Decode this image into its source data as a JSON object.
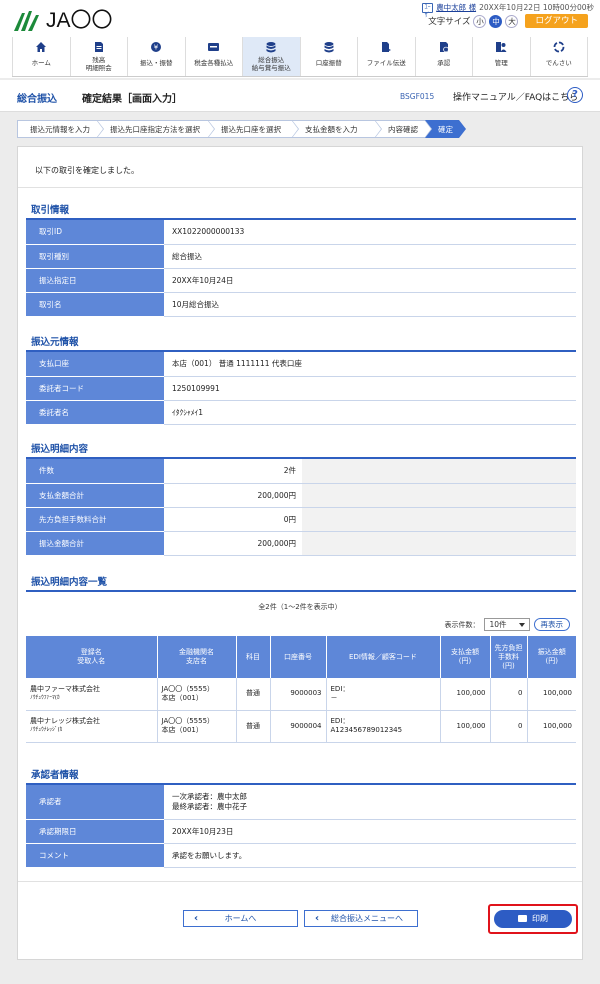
{
  "header": {
    "logo_text": "JA〇〇",
    "user_badge": "ﾕｰｻﾞ",
    "user_name": "農中太郎 様",
    "login_time": "20XX年10月22日 10時00分00秒",
    "font_size_label": "文字サイズ",
    "font_sizes": [
      "小",
      "中",
      "大"
    ],
    "font_size_selected": "中",
    "logout_label": "ログアウト"
  },
  "global_nav": [
    {
      "label": "ホーム",
      "icon": "home-icon"
    },
    {
      "label": "残高\n明細照会",
      "icon": "document-icon"
    },
    {
      "label": "振込・振替",
      "icon": "yen-coin-icon"
    },
    {
      "label": "税金各種払込",
      "icon": "card-icon"
    },
    {
      "label": "総合振込\n給与賞与振込",
      "icon": "coins-stack-icon",
      "active": true
    },
    {
      "label": "口座振替",
      "icon": "coins-stack-icon"
    },
    {
      "label": "ファイル伝送",
      "icon": "file-transfer-icon"
    },
    {
      "label": "承認",
      "icon": "approve-icon"
    },
    {
      "label": "管理",
      "icon": "admin-icon"
    },
    {
      "label": "でんさい",
      "icon": "densai-icon"
    }
  ],
  "title_bar": {
    "section": "総合振込",
    "page": "確定結果［画面入力］",
    "screen_code": "BSGF015",
    "help_link": "操作マニュアル／FAQはこちら",
    "help_icon_text": "?"
  },
  "steps": [
    {
      "label": "振込元情報を入力"
    },
    {
      "label": "振込先口座指定方法を選択"
    },
    {
      "label": "振込先口座を選択"
    },
    {
      "label": "支払金額を入力"
    },
    {
      "label": "内容確認"
    },
    {
      "label": "確定",
      "current": true
    }
  ],
  "message": "以下の取引を確定しました。",
  "transaction": {
    "title": "取引情報",
    "rows": [
      {
        "key": "取引ID",
        "value": "XX1022000000133"
      },
      {
        "key": "取引種別",
        "value": "総合振込"
      },
      {
        "key": "振込指定日",
        "value": "20XX年10月24日"
      },
      {
        "key": "取引名",
        "value": "10月総合振込"
      }
    ]
  },
  "source": {
    "title": "振込元情報",
    "rows": [
      {
        "key": "支払口座",
        "value": "本店（001）  普通 1111111 代表口座"
      },
      {
        "key": "委託者コード",
        "value": "1250109991"
      },
      {
        "key": "委託者名",
        "value": "ｲﾀｸｼｬﾒｲ1"
      }
    ]
  },
  "details": {
    "title": "振込明細内容",
    "rows": [
      {
        "key": "件数",
        "value": "2件"
      },
      {
        "key": "支払金額合計",
        "value": "200,000円"
      },
      {
        "key": "先方負担手数料合計",
        "value": "0円"
      },
      {
        "key": "振込金額合計",
        "value": "200,000円"
      }
    ]
  },
  "detail_list": {
    "title": "振込明細内容一覧",
    "count_text": "全2件（1～2件を表示中）",
    "page_size_label": "表示件数：",
    "page_size_value": "10件",
    "redisplay_label": "再表示",
    "columns": [
      "登録名\n受取人名",
      "金融機関名\n支店名",
      "科目",
      "口座番号",
      "EDI情報／顧客コード",
      "支払金額\n(円)",
      "先方負担\n手数料\n(円)",
      "振込金額\n(円)"
    ],
    "rows": [
      {
        "name": "農中ファーマ株式会社",
        "kana": "ﾉｳﾁｭｳﾌｧｰﾏ(ｶ",
        "bank": "JA〇〇（5555）",
        "branch": "本店（001）",
        "type": "普通",
        "account": "9000003",
        "edi_label": "EDI：",
        "edi": "－",
        "pay": "100,000",
        "fee": "0",
        "transfer": "100,000"
      },
      {
        "name": "農中ナレッジ株式会社",
        "kana": "ﾉｳﾁｭｳﾅﾚｯｼﾞ(ｶ",
        "bank": "JA〇〇（5555）",
        "branch": "本店（001）",
        "type": "普通",
        "account": "9000004",
        "edi_label": "EDI：",
        "edi": "A123456789012345",
        "pay": "100,000",
        "fee": "0",
        "transfer": "100,000"
      }
    ]
  },
  "approver": {
    "title": "承認者情報",
    "approver_key": "承認者",
    "approver_line1": "一次承認者：農中太郎",
    "approver_line2": "最終承認者：農中花子",
    "deadline_key": "承認期限日",
    "deadline_value": "20XX年10月23日",
    "comment_key": "コメント",
    "comment_value": "承認をお願いします。"
  },
  "buttons": {
    "home": "ホームへ",
    "menu": "総合振込メニューへ",
    "print": "印刷"
  },
  "colors": {
    "accent": "#2d5cc4",
    "header_cell": "#5e87d8",
    "logout": "#f5a21d",
    "highlight_border": "#e0131b"
  }
}
